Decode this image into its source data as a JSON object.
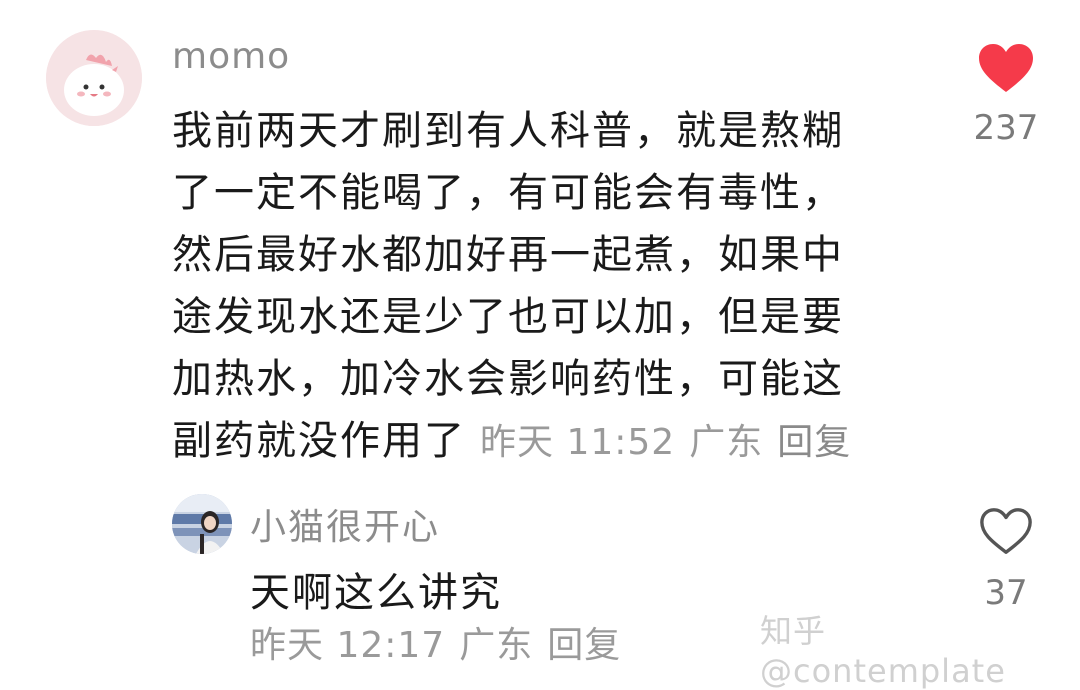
{
  "comment": {
    "username": "momo",
    "lines": [
      "我前两天才刷到有人科普，就是熬糊",
      "了一定不能喝了，有可能会有毒性，",
      "然后最好水都加好再一起煮，如果中",
      "途发现水还是少了也可以加，但是要",
      "加热水，加冷水会影响药性，可能这",
      "副药就没作用了"
    ],
    "time": "昨天 11:52",
    "location": "广东",
    "reply_label": "回复",
    "like_count": "237",
    "liked": true,
    "like_icon": "heart-filled-icon",
    "accent": "#f53a4a"
  },
  "reply": {
    "username": "小猫很开心",
    "text": "天啊这么讲究",
    "time": "昨天 12:17",
    "location": "广东",
    "reply_label": "回复",
    "like_count": "37",
    "liked": false,
    "like_icon": "heart-outline-icon"
  },
  "watermark": "知乎 @contemplate"
}
